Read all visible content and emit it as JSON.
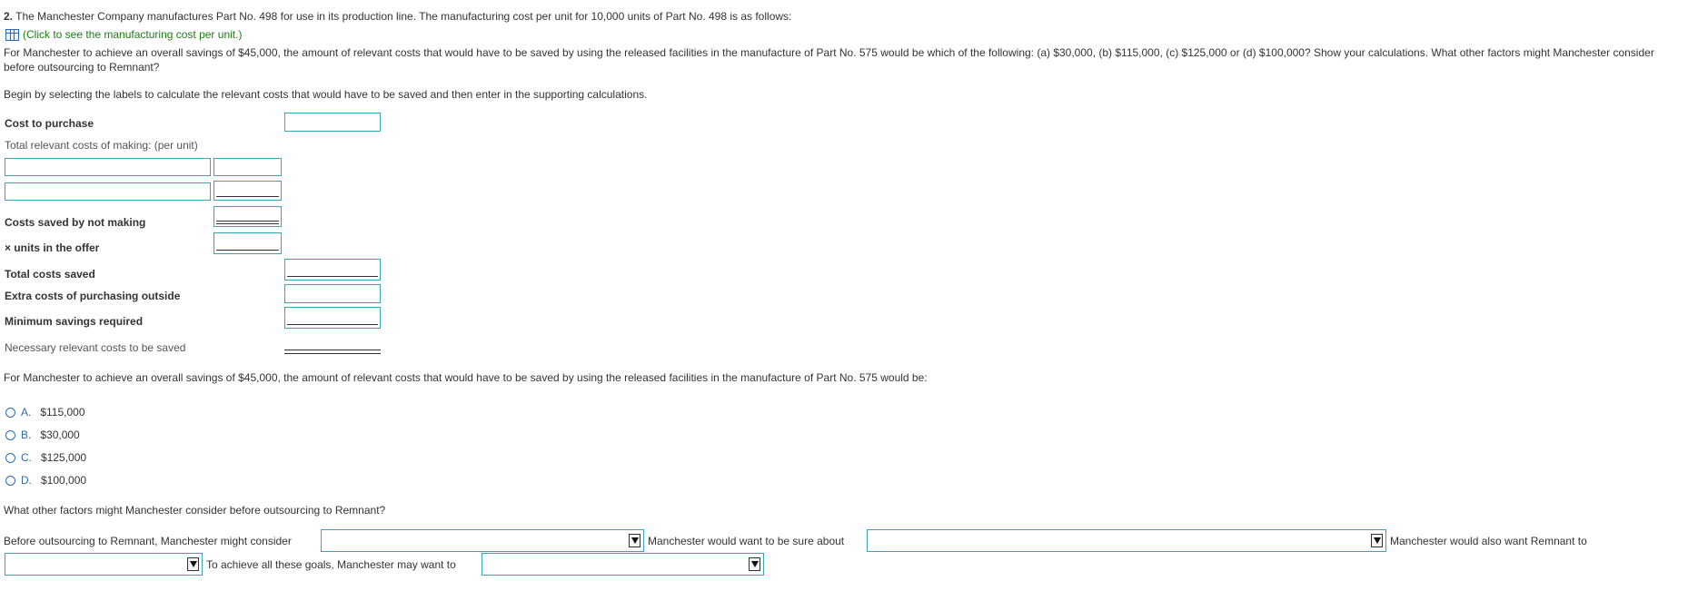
{
  "question": {
    "number": "2.",
    "text": "The Manchester Company manufactures Part No. 498 for use in its production line. The manufacturing cost per unit for 10,000 units of Part No. 498 is as follows:",
    "link_text": "(Click to see the manufacturing cost per unit.)",
    "prompt": "For Manchester to achieve an overall savings of $45,000, the amount of relevant costs that would have to be saved by using the released facilities in the manufacture of Part No. 575 would be which of the following: (a) $30,000, (b) $115,000, (c) $125,000 or (d) $100,000? Show your calculations. What other factors might Manchester consider before outsourcing to Remnant?",
    "instruction": "Begin by selecting the labels to calculate the relevant costs that would have to be saved and then enter in the supporting calculations."
  },
  "calc": {
    "cost_to_purchase": "Cost to purchase",
    "total_relevant_costs": "Total relevant costs of making: (per unit)",
    "costs_saved": "Costs saved by not making",
    "units_offer": "× units in the offer",
    "total_saved": "Total costs saved",
    "extra_costs": "Extra costs of purchasing outside",
    "min_savings": "Minimum savings required",
    "necessary": "Necessary relevant costs to be saved"
  },
  "mc": {
    "stem": "For Manchester to achieve an overall savings of $45,000, the amount of relevant costs that would have to be saved by using the released facilities in the manufacture of Part No. 575 would be:",
    "options": [
      {
        "letter": "A.",
        "text": "$115,000"
      },
      {
        "letter": "B.",
        "text": "$30,000"
      },
      {
        "letter": "C.",
        "text": "$125,000"
      },
      {
        "letter": "D.",
        "text": "$100,000"
      }
    ]
  },
  "factors": {
    "question": "What other factors might Manchester consider before outsourcing to Remnant?",
    "s1": "Before outsourcing to Remnant, Manchester might consider",
    "s2": "Manchester would want to be sure about",
    "s3": "Manchester would also want Remnant to",
    "s4": "To achieve all these goals, Manchester may want to"
  },
  "colors": {
    "link": "#1a7d12",
    "accent": "#2b6cb0",
    "field_border": "#3aa7b0"
  }
}
